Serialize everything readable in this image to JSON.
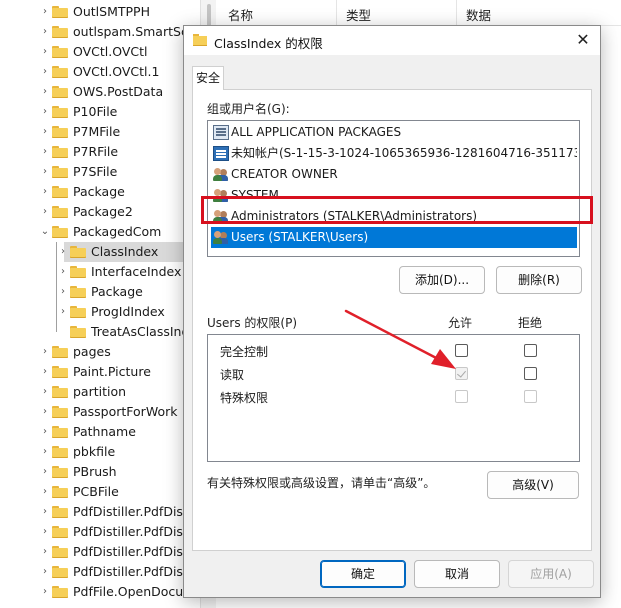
{
  "tree": {
    "items": [
      {
        "label": "OutlSMTPPH",
        "indent": 0,
        "expanded": false
      },
      {
        "label": "outlspam.SmartScr",
        "indent": 0,
        "expanded": false
      },
      {
        "label": "OVCtl.OVCtl",
        "indent": 0,
        "expanded": false
      },
      {
        "label": "OVCtl.OVCtl.1",
        "indent": 0,
        "expanded": false
      },
      {
        "label": "OWS.PostData",
        "indent": 0,
        "expanded": false
      },
      {
        "label": "P10File",
        "indent": 0,
        "expanded": false
      },
      {
        "label": "P7MFile",
        "indent": 0,
        "expanded": false
      },
      {
        "label": "P7RFile",
        "indent": 0,
        "expanded": false
      },
      {
        "label": "P7SFile",
        "indent": 0,
        "expanded": false
      },
      {
        "label": "Package",
        "indent": 0,
        "expanded": false
      },
      {
        "label": "Package2",
        "indent": 0,
        "expanded": false
      },
      {
        "label": "PackagedCom",
        "indent": 0,
        "expanded": true
      },
      {
        "label": "ClassIndex",
        "indent": 1,
        "expanded": false,
        "selected": true
      },
      {
        "label": "InterfaceIndex",
        "indent": 1,
        "expanded": false
      },
      {
        "label": "Package",
        "indent": 1,
        "expanded": false
      },
      {
        "label": "ProgIdIndex",
        "indent": 1,
        "expanded": false
      },
      {
        "label": "TreatAsClassInd",
        "indent": 1,
        "expanded": null
      },
      {
        "label": "pages",
        "indent": 0,
        "expanded": false
      },
      {
        "label": "Paint.Picture",
        "indent": 0,
        "expanded": false
      },
      {
        "label": "partition",
        "indent": 0,
        "expanded": false
      },
      {
        "label": "PassportForWork",
        "indent": 0,
        "expanded": false
      },
      {
        "label": "Pathname",
        "indent": 0,
        "expanded": false
      },
      {
        "label": "pbkfile",
        "indent": 0,
        "expanded": false
      },
      {
        "label": "PBrush",
        "indent": 0,
        "expanded": false
      },
      {
        "label": "PCBFile",
        "indent": 0,
        "expanded": false
      },
      {
        "label": "PdfDistiller.PdfDisti",
        "indent": 0,
        "expanded": false
      },
      {
        "label": "PdfDistiller.PdfDisti",
        "indent": 0,
        "expanded": false
      },
      {
        "label": "PdfDistiller.PdfDisti",
        "indent": 0,
        "expanded": false
      },
      {
        "label": "PdfDistiller.PdfDisti",
        "indent": 0,
        "expanded": false
      },
      {
        "label": "PdfFile.OpenDocum",
        "indent": 0,
        "expanded": false
      }
    ]
  },
  "list_header": {
    "name": "名称",
    "type": "类型",
    "data": "数据"
  },
  "dialog": {
    "title": "ClassIndex 的权限",
    "close_glyph": "✕",
    "tab_label": "安全",
    "group_label": "组或用户名(G):",
    "groups": [
      {
        "label": "ALL APPLICATION PACKAGES",
        "icon": "package-icon"
      },
      {
        "label": "未知帐户(S-1-15-3-1024-1065365936-1281604716-351173...",
        "icon": "unknown-account-icon"
      },
      {
        "label": "CREATOR OWNER",
        "icon": "users-icon"
      },
      {
        "label": "SYSTEM",
        "icon": "users-icon"
      },
      {
        "label": "Administrators (STALKER\\Administrators)",
        "icon": "users-icon"
      },
      {
        "label": "Users (STALKER\\Users)",
        "icon": "users-icon",
        "selected": true
      }
    ],
    "add_button": "添加(D)...",
    "remove_button": "删除(R)",
    "perm_label": "Users 的权限(P)",
    "allow_header": "允许",
    "deny_header": "拒绝",
    "permissions": [
      {
        "name": "完全控制",
        "allow": "unchecked",
        "deny": "unchecked"
      },
      {
        "name": "读取",
        "allow": "checked-disabled",
        "deny": "unchecked"
      },
      {
        "name": "特殊权限",
        "allow": "disabled",
        "deny": "disabled"
      }
    ],
    "advanced_hint": "有关特殊权限或高级设置，请单击“高级”。",
    "advanced_button": "高级(V)",
    "ok_button": "确定",
    "cancel_button": "取消",
    "apply_button": "应用(A)"
  },
  "colors": {
    "selection": "#0078d7",
    "highlight_box": "#d7101e",
    "annotation_arrow": "#e0202a"
  }
}
